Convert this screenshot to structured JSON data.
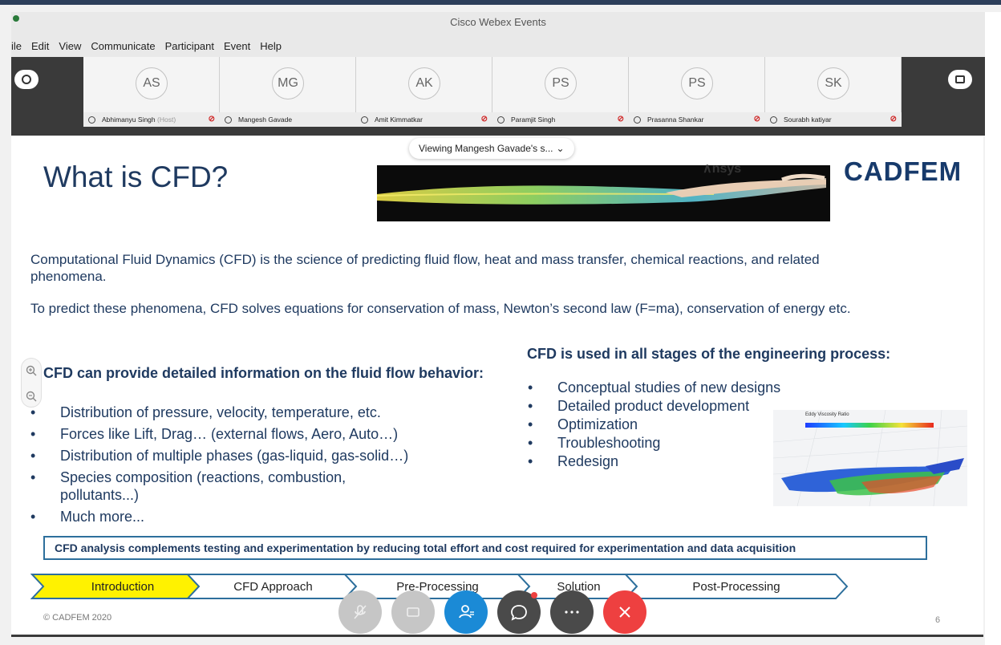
{
  "window": {
    "title": "Cisco Webex Events"
  },
  "menu": {
    "items": [
      "ile",
      "Edit",
      "View",
      "Communicate",
      "Participant",
      "Event",
      "Help"
    ]
  },
  "participants": [
    {
      "initials": "AS",
      "name": "Abhimanyu Singh",
      "host_tag": "(Host)"
    },
    {
      "initials": "MG",
      "name": "Mangesh Gavade",
      "host_tag": ""
    },
    {
      "initials": "AK",
      "name": "Amit Kimmatkar",
      "host_tag": ""
    },
    {
      "initials": "PS",
      "name": "Paramjit Singh",
      "host_tag": ""
    },
    {
      "initials": "PS",
      "name": "Prasanna Shankar",
      "host_tag": ""
    },
    {
      "initials": "SK",
      "name": "Sourabh katiyar",
      "host_tag": ""
    }
  ],
  "share_status": {
    "text": "Viewing Mangesh Gavade's s..."
  },
  "slide": {
    "title": "What is CFD?",
    "logo": "CADFEM",
    "partner_logo": "∧nsys",
    "para1": "Computational Fluid Dynamics (CFD) is the science of predicting fluid flow, heat and mass transfer, chemical reactions, and related phenomena.",
    "para2": "To predict these phenomena, CFD solves equations for conservation of mass, Newton’s second law (F=ma), conservation of energy etc.",
    "left_heading": "CFD can provide detailed information on the fluid flow behavior:",
    "left_bullets": [
      "Distribution of pressure, velocity, temperature, etc.",
      "Forces like Lift, Drag… (external flows, Aero, Auto…)",
      "Distribution of multiple phases (gas-liquid, gas-solid…)",
      "Species composition (reactions, combustion, pollutants...)",
      "Much more..."
    ],
    "right_heading": "CFD is used in all stages of the engineering process:",
    "right_bullets": [
      "Conceptual studies of new designs",
      "Detailed product development",
      "Optimization",
      "Troubleshooting",
      "Redesign"
    ],
    "sim_legend": "Eddy Viscosity Ratio",
    "callout": "CFD analysis complements testing and experimentation by reducing total effort and cost required for experimentation and data acquisition",
    "steps": [
      "Introduction",
      "CFD Approach",
      "Pre-Processing",
      "Solution",
      "Post-Processing"
    ],
    "active_step": "Introduction",
    "copyright": "© CADFEM 2020",
    "page_number": "6"
  },
  "colors": {
    "title_blue": "#1f3a60",
    "active_step_fill": "#fff200",
    "step_border": "#2d6f9c",
    "end_button": "#ee4040",
    "participants_button": "#1b8ad6"
  },
  "controls": [
    "mute-button",
    "video-button",
    "participants-button",
    "chat-button",
    "more-button",
    "end-button"
  ]
}
